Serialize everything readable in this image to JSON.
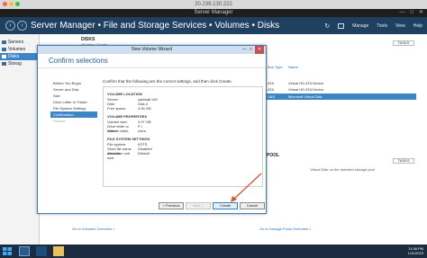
{
  "mac": {
    "ip": "20.239.130.222"
  },
  "window": {
    "title": "Server Manager"
  },
  "header": {
    "breadcrumb": "Server Manager • File and Storage Services • Volumes • Disks",
    "tools": [
      "Manage",
      "Tools",
      "View",
      "Help"
    ]
  },
  "sidebar": {
    "items": [
      {
        "label": "Servers",
        "active": false
      },
      {
        "label": "Volumes",
        "active": false
      },
      {
        "label": "Disks",
        "active": true
      },
      {
        "label": "Storag",
        "active": false
      }
    ]
  },
  "disks_panel": {
    "title": "DISKS",
    "subtitle": "All disks | 3 total"
  },
  "right_panel": {
    "tasks": "TASKS",
    "columns": [
      "Bus Type",
      "Name"
    ],
    "rows": [
      {
        "bus": "ATA",
        "name": "Virtual HD ATA Device",
        "selected": false
      },
      {
        "bus": "ATA",
        "name": "Virtual HD ATA Device",
        "selected": false
      },
      {
        "bus": "SAS",
        "name": "Microsoft Virtual Disk",
        "selected": true
      }
    ]
  },
  "storage_pool": {
    "label": "POOL",
    "tasks": "TASKS",
    "message": "Virtual Disk on the selected storage pool"
  },
  "links": {
    "volumes": "Go to Volumes Overview >",
    "pools": "Go to Storage Pools Overview >"
  },
  "wizard": {
    "title": "New Volume Wizard",
    "heading": "Confirm selections",
    "steps": [
      {
        "label": "Before You Begin",
        "state": "normal"
      },
      {
        "label": "Server and Disk",
        "state": "normal"
      },
      {
        "label": "Size",
        "state": "normal"
      },
      {
        "label": "Drive Letter or Folder",
        "state": "normal"
      },
      {
        "label": "File System Settings",
        "state": "normal"
      },
      {
        "label": "Confirmation",
        "state": "active"
      },
      {
        "label": "Results",
        "state": "disabled"
      }
    ],
    "intro": "Confirm that the following are the correct settings, and then click Create.",
    "sections": [
      {
        "title": "VOLUME LOCATION",
        "rows": [
          {
            "k": "Server:",
            "v": "cpiswati-VM"
          },
          {
            "k": "Disk:",
            "v": "Disk 2"
          },
          {
            "k": "Free space:",
            "v": "4.00 GB"
          }
        ]
      },
      {
        "title": "VOLUME PROPERTIES",
        "rows": [
          {
            "k": "Volume size:",
            "v": "3.97 GB"
          },
          {
            "k": "Drive letter or folder:",
            "v": "F:\\"
          },
          {
            "k": "Volume label:",
            "v": "extra"
          }
        ]
      },
      {
        "title": "FILE SYSTEM SETTINGS",
        "rows": [
          {
            "k": "File system:",
            "v": "NTFS"
          },
          {
            "k": "Short file name creation:",
            "v": "Disabled"
          },
          {
            "k": "Allocation unit size:",
            "v": "Default"
          }
        ]
      }
    ],
    "buttons": {
      "previous": "< Previous",
      "next": "Next >",
      "create": "Create",
      "cancel": "Cancel"
    }
  },
  "taskbar": {
    "time": "11:38 PM",
    "date": "1/11/2023"
  },
  "colors": {
    "header": "#204060",
    "accent": "#3d86c6",
    "arrow": "#e0522a"
  }
}
